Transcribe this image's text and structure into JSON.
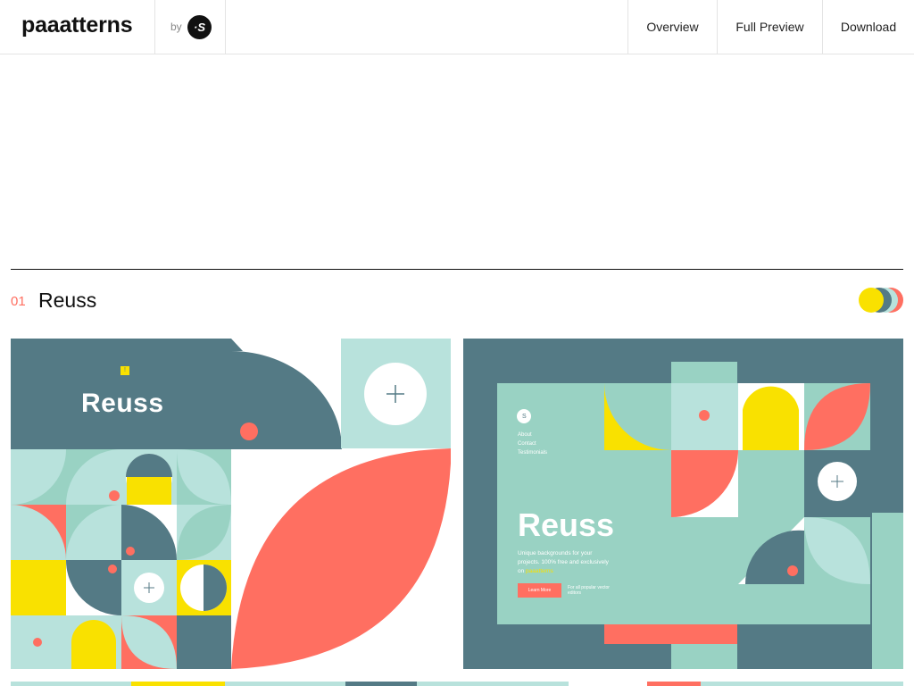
{
  "header": {
    "brand": "paaatterns",
    "by_label": "by",
    "by_logo": "·S"
  },
  "nav": {
    "items": [
      {
        "label": "Overview"
      },
      {
        "label": "Full Preview"
      },
      {
        "label": "Download"
      }
    ]
  },
  "section": {
    "number": "01",
    "title": "Reuss",
    "swatches": [
      "#ff6f61",
      "#b8e2dc",
      "#547a85",
      "#f9e100"
    ]
  },
  "card1": {
    "title": "Reuss",
    "badge": "!"
  },
  "card2": {
    "menu": [
      "About",
      "Contact",
      "Testimonials"
    ],
    "logo": "S",
    "title": "Reuss",
    "lines": [
      "Unique backgrounds for your",
      "projects. 100% free and exclusively"
    ],
    "line3_prefix": "on",
    "line3_link": "paaatterns",
    "button": "Learn More",
    "note": [
      "For all popular vector",
      "editors"
    ]
  },
  "colors": {
    "slate": "#547a85",
    "mint": "#99d2c3",
    "light_mint": "#b8e2dc",
    "coral": "#ff6f61",
    "yellow": "#f9e100",
    "white": "#ffffff"
  }
}
